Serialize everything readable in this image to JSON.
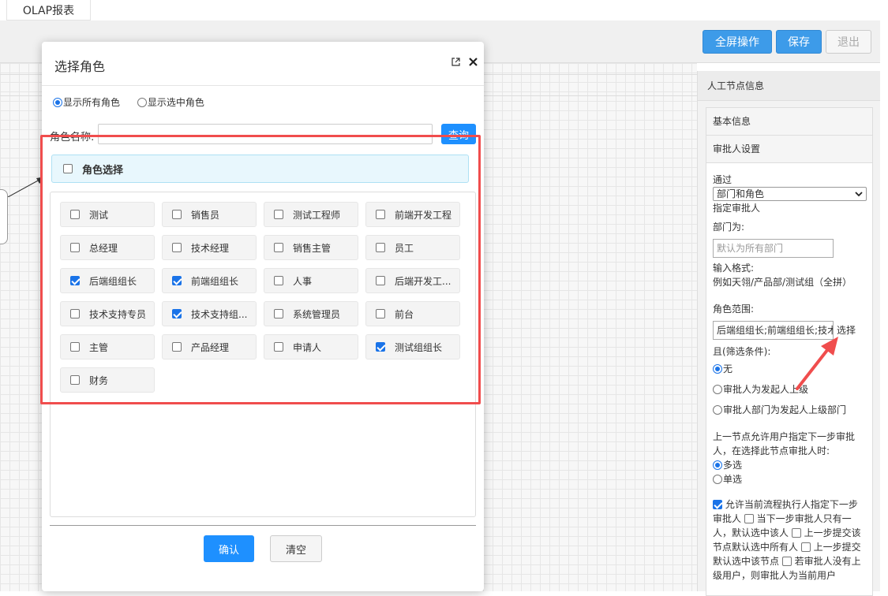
{
  "tabbar": {
    "active_tab": "OLAP报表"
  },
  "toolbar": {
    "fullscreen_label": "全屏操作",
    "save_label": "保存",
    "exit_label": "退出"
  },
  "modal": {
    "title": "选择角色",
    "radio_all": "显示所有角色",
    "radio_selected": "显示选中角色",
    "search_label": "角色名称:",
    "search_value": "",
    "search_button": "查询",
    "role_header": "角色选择",
    "roles": [
      {
        "label": "测试",
        "checked": false
      },
      {
        "label": "销售员",
        "checked": false
      },
      {
        "label": "测试工程师",
        "checked": false
      },
      {
        "label": "前端开发工程",
        "checked": false
      },
      {
        "label": "总经理",
        "checked": false
      },
      {
        "label": "技术经理",
        "checked": false
      },
      {
        "label": "销售主管",
        "checked": false
      },
      {
        "label": "员工",
        "checked": false
      },
      {
        "label": "后端组组长",
        "checked": true
      },
      {
        "label": "前端组组长",
        "checked": true
      },
      {
        "label": "人事",
        "checked": false
      },
      {
        "label": "后端开发工...",
        "checked": false
      },
      {
        "label": "技术支持专员",
        "checked": false
      },
      {
        "label": "技术支持组...",
        "checked": true
      },
      {
        "label": "系统管理员",
        "checked": false
      },
      {
        "label": "前台",
        "checked": false
      },
      {
        "label": "主管",
        "checked": false
      },
      {
        "label": "产品经理",
        "checked": false
      },
      {
        "label": "申请人",
        "checked": false
      },
      {
        "label": "测试组组长",
        "checked": true
      },
      {
        "label": "财务",
        "checked": false
      }
    ],
    "confirm_label": "确认",
    "clear_label": "清空"
  },
  "panel": {
    "title": "人工节点信息",
    "section_basic": "基本信息",
    "section_approver": "审批人设置",
    "pass_label": "通过",
    "pass_select": "部门和角色",
    "assign_label": "指定审批人",
    "dept_label": "部门为:",
    "dept_placeholder": "默认为所有部门",
    "format_label": "输入格式:",
    "format_example": "例如天翎/产品部/测试组（全拼）",
    "role_range_label": "角色范围:",
    "role_range_value": "后端组组长;前端组组长;技术",
    "select_link": "选择",
    "filter_label": "且(筛选条件):",
    "filter_none": "无",
    "filter_opt1": "审批人为发起人上级",
    "filter_opt2": "审批人部门为发起人上级部门",
    "next_step_text": "上一节点允许用户指定下一步审批人，在选择此节点审批人时:",
    "multi_label": "多选",
    "single_label": "单选",
    "allow_text": "允许当前流程执行人指定下一步审批人",
    "only_one_text": "当下一步审批人只有一人，默认选中该人",
    "submit_all_text": "上一步提交该节点默认选中所有人",
    "submit_node_text": "上一步提交默认选中该节点",
    "no_approver_text": "若审批人没有上级用户，则审批人为当前用户"
  },
  "colors": {
    "primary": "#1e90ff",
    "highlight": "#f04d4d",
    "checked": "#1a73e8"
  }
}
